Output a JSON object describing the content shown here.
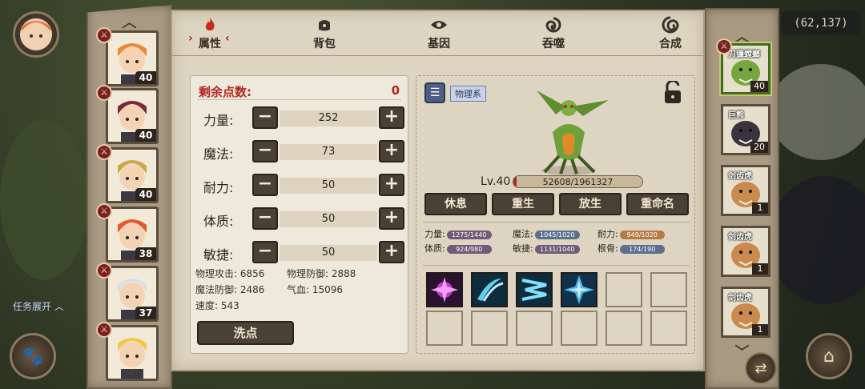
{
  "hud": {
    "coords": "(62,137)",
    "quest_toggle": "任务展开"
  },
  "tabs": [
    {
      "label": "属性",
      "icon": "attributes-icon"
    },
    {
      "label": "背包",
      "icon": "bag-icon"
    },
    {
      "label": "基因",
      "icon": "gene-icon"
    },
    {
      "label": "吞噬",
      "icon": "devour-icon"
    },
    {
      "label": "合成",
      "icon": "synthesis-icon"
    }
  ],
  "attributes": {
    "points_label": "剩余点数:",
    "points_value": "0",
    "stats": [
      {
        "label": "力量:",
        "value": "252"
      },
      {
        "label": "魔法:",
        "value": "73"
      },
      {
        "label": "耐力:",
        "value": "50"
      },
      {
        "label": "体质:",
        "value": "50"
      },
      {
        "label": "敏捷:",
        "value": "50"
      }
    ],
    "derived": [
      {
        "label": "物理攻击:",
        "value": "6856"
      },
      {
        "label": "物理防御:",
        "value": "2888"
      },
      {
        "label": "魔法防御:",
        "value": "2486"
      },
      {
        "label": "气血:",
        "value": "15096"
      },
      {
        "label": "速度:",
        "value": "543"
      }
    ],
    "reset_label": "洗点"
  },
  "pet": {
    "class_tag": "物理系",
    "level_label": "Lv.40",
    "exp_text": "52608/1961327",
    "exp_fraction": 0.027,
    "actions": [
      "休息",
      "重生",
      "放生",
      "重命名"
    ],
    "aptitudes": [
      {
        "label": "力量:",
        "value": "1275/1440"
      },
      {
        "label": "魔法:",
        "value": "1045/1020"
      },
      {
        "label": "耐力:",
        "value": "949/1020"
      },
      {
        "label": "体质:",
        "value": "924/980"
      },
      {
        "label": "敏捷:",
        "value": "1131/1040"
      },
      {
        "label": "根骨:",
        "value": "174/190"
      }
    ]
  },
  "characters": [
    {
      "level": "40",
      "hair": "#e98a3b"
    },
    {
      "level": "40",
      "hair": "#7c2a3a"
    },
    {
      "level": "40",
      "hair": "#c8a84a"
    },
    {
      "level": "38",
      "hair": "#e6592b"
    },
    {
      "level": "37",
      "hair": "#d9dde6"
    },
    {
      "level": "",
      "hair": "#f0c84a"
    }
  ],
  "pets": [
    {
      "name": "刀镰螳螂",
      "level": "40"
    },
    {
      "name": "巨熊",
      "level": "20"
    },
    {
      "name": "剑齿虎",
      "level": "1"
    },
    {
      "name": "剑齿虎",
      "level": "1"
    },
    {
      "name": "剑齿虎",
      "level": "1"
    }
  ],
  "colors": {
    "panel_bg": "#ddd5c2",
    "accent_red": "#b3261e",
    "button_dark": "#4a4035"
  }
}
